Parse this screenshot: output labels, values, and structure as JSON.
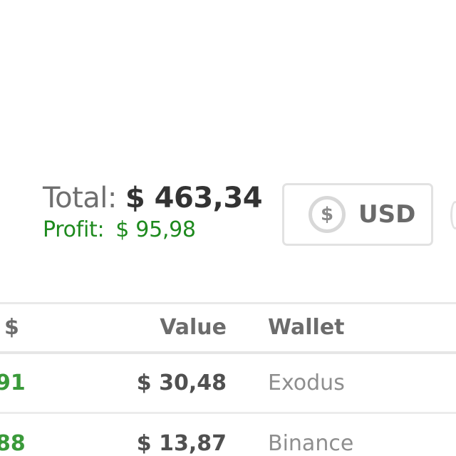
{
  "summary": {
    "total_label": "Total:",
    "total_value": "$ 463,34",
    "profit_label": "Profit:",
    "profit_value": "$ 95,98"
  },
  "currency_button": {
    "icon": "dollar-circle-icon",
    "symbol": "$",
    "label": "USD"
  },
  "table": {
    "headers": {
      "change": "$",
      "value": "Value",
      "wallet": "Wallet"
    },
    "rows": [
      {
        "change": "91",
        "value": "$ 30,48",
        "wallet": "Exodus"
      },
      {
        "change": "88",
        "value": "$ 13,87",
        "wallet": "Binance"
      }
    ]
  },
  "colors": {
    "profit": "#1e8a1e",
    "change_positive": "#3a9a3a",
    "border": "#e2e2e2"
  }
}
